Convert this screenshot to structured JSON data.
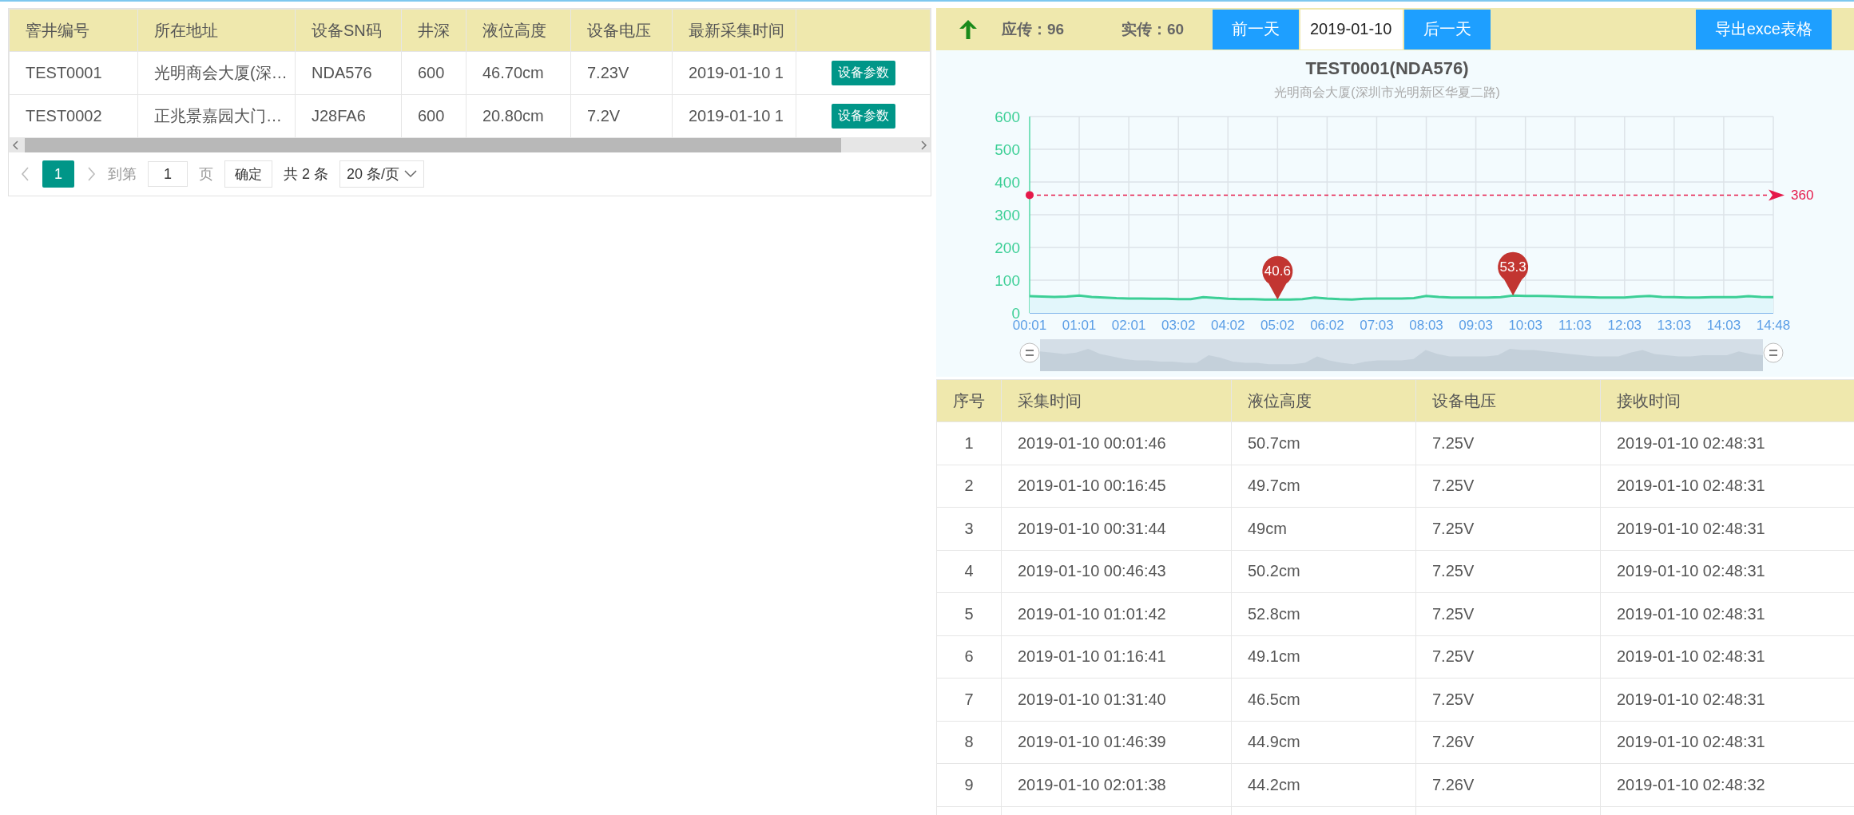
{
  "device_table": {
    "columns": [
      "窨井编号",
      "所在地址",
      "设备SN码",
      "井深",
      "液位高度",
      "设备电压",
      "最新采集时间"
    ],
    "rows": [
      {
        "cells": [
          "TEST0001",
          "光明商会大厦(深…",
          "NDA576",
          "600",
          "46.70cm",
          "7.23V",
          "2019-01-10 1"
        ],
        "action": "设备参数"
      },
      {
        "cells": [
          "TEST0002",
          "正兆景嘉园大门…",
          "J28FA6",
          "600",
          "20.80cm",
          "7.2V",
          "2019-01-10 1"
        ],
        "action": "设备参数"
      }
    ]
  },
  "pagination": {
    "pages": [
      {
        "label": "1",
        "selected": true
      }
    ],
    "goto_label": "到第",
    "goto_value": "1",
    "page_unit": "页",
    "confirm": "确定",
    "total": "共 2 条",
    "page_size": "20 条/页"
  },
  "toolbar": {
    "expected": "应传：96",
    "actual": "实传：60",
    "prev_button": "前一天",
    "date": "2019-01-10",
    "next_button": "后一天",
    "export_button": "导出exce表格"
  },
  "chart": {
    "title": "TEST0001(NDA576)",
    "subtitle": "光明商会大厦(深圳市光明新区华夏二路)",
    "chart_data": {
      "type": "area",
      "grid": true,
      "ylim": [
        0,
        600
      ],
      "yticks": [
        0,
        100,
        200,
        300,
        400,
        500,
        600
      ],
      "categories": [
        "00:01",
        null,
        null,
        null,
        "01:01",
        null,
        null,
        null,
        "02:01",
        null,
        null,
        null,
        "03:02",
        null,
        null,
        null,
        "04:02",
        null,
        null,
        null,
        "05:02",
        null,
        null,
        null,
        "06:02",
        null,
        null,
        null,
        "07:03",
        null,
        null,
        null,
        "08:03",
        null,
        null,
        null,
        "09:03",
        null,
        null,
        null,
        "10:03",
        null,
        null,
        null,
        "11:03",
        null,
        null,
        null,
        "12:03",
        null,
        null,
        null,
        "13:03",
        null,
        null,
        null,
        "14:03",
        null,
        null,
        null,
        "14:48"
      ],
      "series": [
        {
          "color": "#3ccf96",
          "values": [
            51,
            50,
            49,
            50,
            53,
            49,
            47,
            45,
            44,
            44,
            43,
            43,
            42,
            42,
            48,
            46,
            43,
            42,
            42,
            41,
            41,
            41,
            42,
            47,
            44,
            42,
            41,
            43,
            44,
            44,
            44,
            45,
            52,
            49,
            47,
            47,
            47,
            47,
            48,
            53,
            52,
            52,
            51,
            50,
            49,
            48,
            47,
            47,
            47,
            50,
            52,
            49,
            48,
            47,
            47,
            48,
            48,
            48,
            51,
            49,
            48
          ]
        }
      ],
      "annotations": [
        {
          "x": "05:02",
          "y": 40.6,
          "text": "40.6"
        },
        {
          "y": 53.3,
          "text": "53.3"
        }
      ],
      "ref_lines": [
        {
          "axis": "y",
          "value": 360,
          "label": "360"
        }
      ]
    }
  },
  "readings_table": {
    "columns": [
      "序号",
      "采集时间",
      "液位高度",
      "设备电压",
      "接收时间"
    ],
    "rows": [
      [
        "1",
        "2019-01-10 00:01:46",
        "50.7cm",
        "7.25V",
        "2019-01-10 02:48:31"
      ],
      [
        "2",
        "2019-01-10 00:16:45",
        "49.7cm",
        "7.25V",
        "2019-01-10 02:48:31"
      ],
      [
        "3",
        "2019-01-10 00:31:44",
        "49cm",
        "7.25V",
        "2019-01-10 02:48:31"
      ],
      [
        "4",
        "2019-01-10 00:46:43",
        "50.2cm",
        "7.25V",
        "2019-01-10 02:48:31"
      ],
      [
        "5",
        "2019-01-10 01:01:42",
        "52.8cm",
        "7.25V",
        "2019-01-10 02:48:31"
      ],
      [
        "6",
        "2019-01-10 01:16:41",
        "49.1cm",
        "7.25V",
        "2019-01-10 02:48:31"
      ],
      [
        "7",
        "2019-01-10 01:31:40",
        "46.5cm",
        "7.25V",
        "2019-01-10 02:48:31"
      ],
      [
        "8",
        "2019-01-10 01:46:39",
        "44.9cm",
        "7.26V",
        "2019-01-10 02:48:31"
      ],
      [
        "9",
        "2019-01-10 02:01:38",
        "44.2cm",
        "7.26V",
        "2019-01-10 02:48:32"
      ]
    ]
  }
}
